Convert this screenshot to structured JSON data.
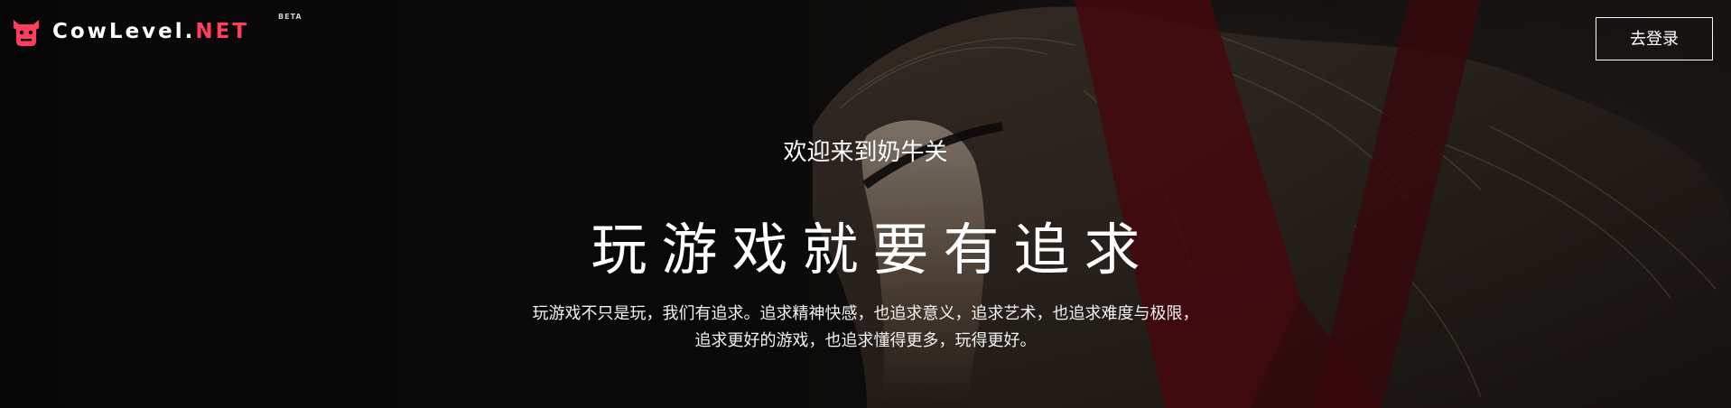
{
  "header": {
    "logo_text_main": "CowLevel.",
    "logo_text_accent": "NET",
    "logo_badge": "BETA",
    "login_label": "去登录"
  },
  "hero": {
    "welcome": "欢迎来到奶牛关",
    "headline": "玩游戏就要有追求",
    "description_line1": "玩游戏不只是玩，我们有追求。追求精神快感，也追求意义，追求艺术，也追求难度与极限，",
    "description_line2": "追求更好的游戏，也追求懂得更多，玩得更好。"
  },
  "colors": {
    "accent": "#ff3d5f",
    "background": "#0b0b0b",
    "art_red": "#5a0b12",
    "text": "#ffffff"
  },
  "icons": {
    "logo": "cow-head-icon"
  }
}
